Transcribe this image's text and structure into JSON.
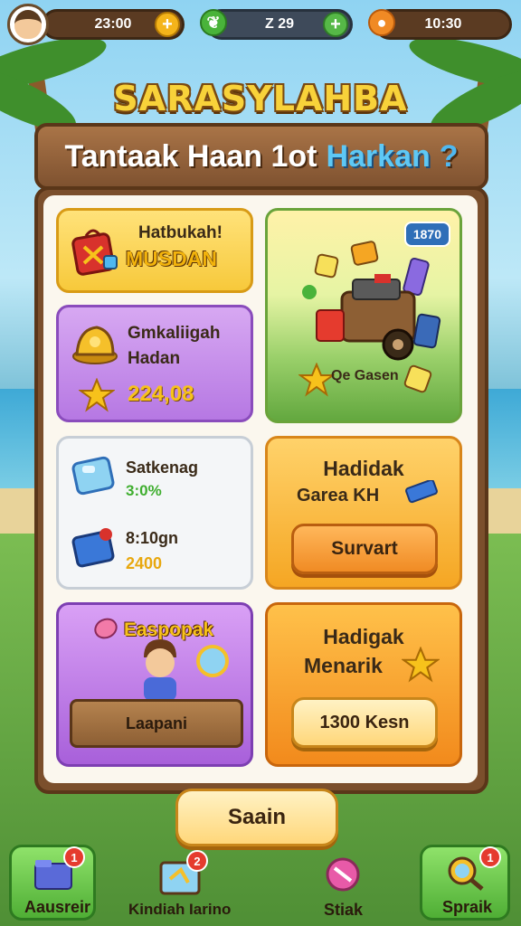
{
  "topbar": {
    "currency1": "23:00",
    "currency2": "Z 29",
    "currency3": "10:30"
  },
  "logo": "SARASYLAHBA",
  "banner": {
    "text_main": "Tantaak Haan 1ot",
    "text_highlight": "Harkan",
    "text_q": "?"
  },
  "cards": {
    "yellow": {
      "line1": "Hatbukah!",
      "line2": "MUSDAN"
    },
    "purple1": {
      "line1": "Gmkaliigah",
      "line2": "Hadan",
      "value": "224,08"
    },
    "scene": {
      "badge": "1870",
      "label": "Qe Gasen"
    },
    "white": {
      "item1_name": "Satkenag",
      "item1_value": "3:0%",
      "item2_name": "8:10gn",
      "item2_value": "2400"
    },
    "orange1": {
      "line1": "Hadidak",
      "line2": "Garea KH",
      "button": "Survart"
    },
    "purple2": {
      "title": "Easpopak",
      "sign": "Laapani"
    },
    "orange2": {
      "line1": "Hadigak",
      "line2": "Menarik",
      "button": "1300 Kesn"
    }
  },
  "main_button": "Saain",
  "nav": {
    "item1": {
      "label": "Aausreir",
      "badge": "1"
    },
    "item2": {
      "label": "Kindiah Iarino",
      "badge": "2"
    },
    "item3": {
      "label": "Stiak"
    },
    "item4": {
      "label": "Spraik",
      "badge": "1"
    }
  },
  "colors": {
    "accent_gold": "#f7c21b",
    "panel_wood": "#7b4f2c",
    "highlight_blue": "#5ec8f5"
  }
}
